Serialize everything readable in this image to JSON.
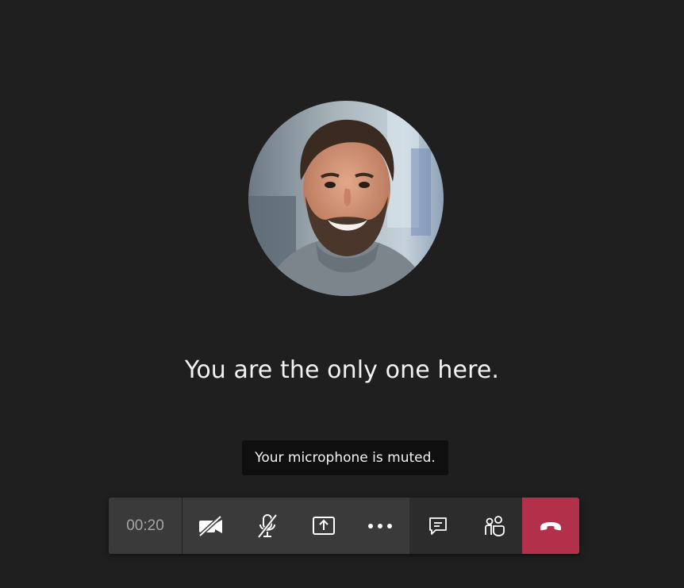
{
  "meeting": {
    "status_message": "You are the only one here.",
    "mic_tooltip": "Your microphone is muted."
  },
  "toolbar": {
    "timer": "00:20",
    "buttons": [
      {
        "name": "camera-off",
        "icon": "video-off-icon"
      },
      {
        "name": "mic-muted",
        "icon": "mic-off-icon"
      },
      {
        "name": "share-screen",
        "icon": "share-tray-icon"
      },
      {
        "name": "more-actions",
        "icon": "ellipsis-icon"
      },
      {
        "name": "chat",
        "icon": "chat-icon"
      },
      {
        "name": "participants",
        "icon": "people-icon"
      },
      {
        "name": "hang-up",
        "icon": "phone-hangup-icon"
      }
    ],
    "hangup_color": "#b3304a"
  },
  "colors": {
    "background": "#1f1f1f",
    "toolbar": "#3a3a3a",
    "toolbar_side": "#2c2c2c",
    "tooltip": "#0f0f0f"
  }
}
